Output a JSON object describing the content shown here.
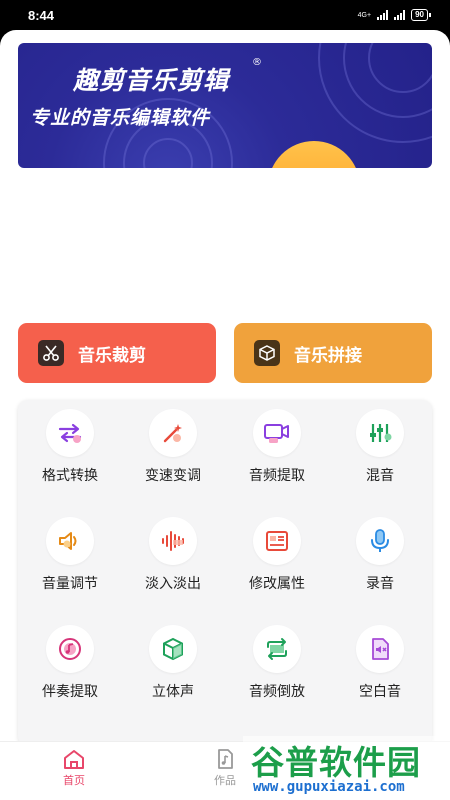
{
  "status": {
    "time": "8:44",
    "network": "4G+",
    "battery": "90"
  },
  "banner": {
    "title": "趣剪音乐剪辑",
    "mark": "®",
    "subtitle": "专业的音乐编辑软件"
  },
  "actions": {
    "cut_label": "音乐裁剪",
    "join_label": "音乐拼接"
  },
  "tools": [
    {
      "label": "格式转换",
      "icon": "format-convert-icon"
    },
    {
      "label": "变速变调",
      "icon": "magic-wand-icon"
    },
    {
      "label": "音频提取",
      "icon": "video-extract-icon"
    },
    {
      "label": "混音",
      "icon": "mixer-icon"
    },
    {
      "label": "音量调节",
      "icon": "volume-icon"
    },
    {
      "label": "淡入淡出",
      "icon": "waveform-icon"
    },
    {
      "label": "修改属性",
      "icon": "properties-icon"
    },
    {
      "label": "录音",
      "icon": "microphone-icon"
    },
    {
      "label": "伴奏提取",
      "icon": "music-disc-icon"
    },
    {
      "label": "立体声",
      "icon": "cube-icon"
    },
    {
      "label": "音频倒放",
      "icon": "reverse-icon"
    },
    {
      "label": "空白音",
      "icon": "silent-file-icon"
    }
  ],
  "tabbar": {
    "home": "首页",
    "works": "作品"
  },
  "watermark": {
    "text": "谷普软件园",
    "url": "www.gupuxiazai.com"
  },
  "colors": {
    "cut": "#f5604c",
    "join": "#f0a23c",
    "active_tab": "#e8476a",
    "banner": "#2c2b98"
  }
}
